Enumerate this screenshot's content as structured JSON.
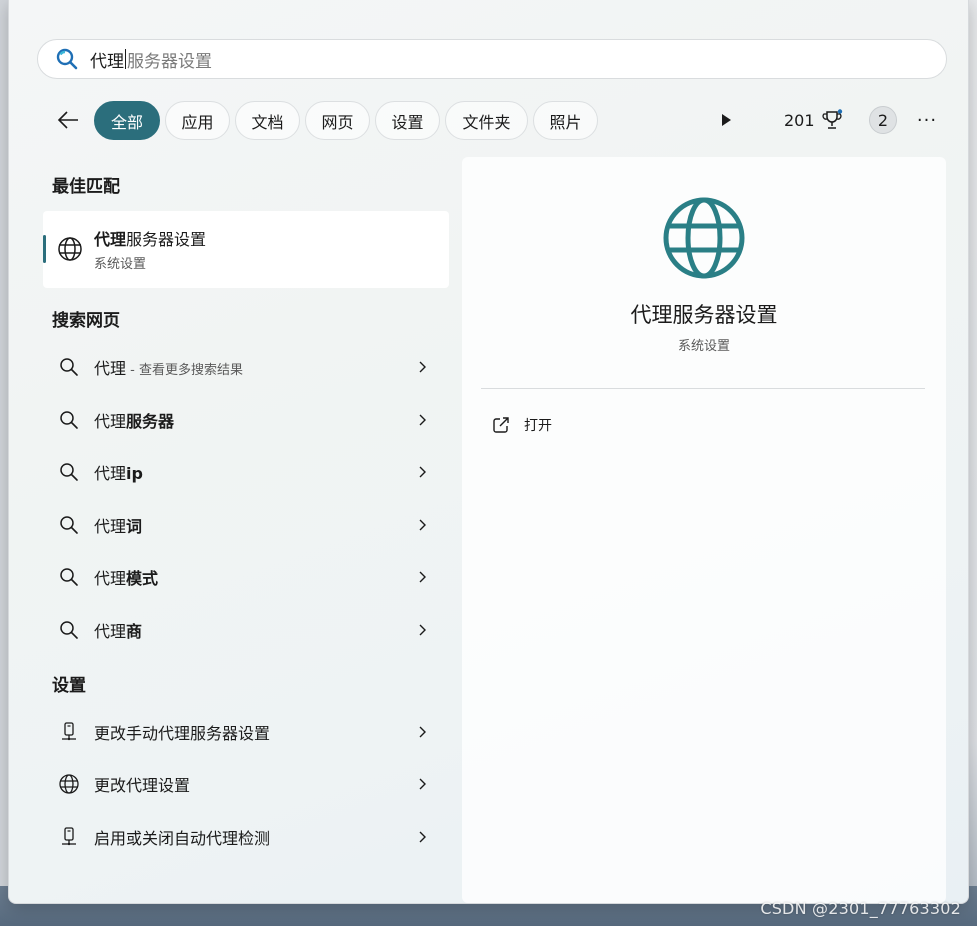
{
  "search": {
    "typed": "代理",
    "suggestion": "服务器设置"
  },
  "filters": {
    "back_icon": "arrow-left-icon",
    "chips": [
      {
        "label": "全部",
        "active": true
      },
      {
        "label": "应用",
        "active": false
      },
      {
        "label": "文档",
        "active": false
      },
      {
        "label": "网页",
        "active": false
      },
      {
        "label": "设置",
        "active": false
      },
      {
        "label": "文件夹",
        "active": false
      },
      {
        "label": "照片",
        "active": false
      }
    ],
    "points": "201",
    "badge": "2",
    "more": "···"
  },
  "best_match": {
    "heading": "最佳匹配",
    "title_bold": "代理",
    "title_rest": "服务器设置",
    "subtitle": "系统设置",
    "icon": "globe-icon"
  },
  "web": {
    "heading": "搜索网页",
    "items": [
      {
        "prefix": "代理",
        "bold": "",
        "hint": " - 查看更多搜索结果"
      },
      {
        "prefix": "代理",
        "bold": "服务器",
        "hint": ""
      },
      {
        "prefix": "代理",
        "bold": "ip",
        "hint": ""
      },
      {
        "prefix": "代理",
        "bold": "词",
        "hint": ""
      },
      {
        "prefix": "代理",
        "bold": "模式",
        "hint": ""
      },
      {
        "prefix": "代理",
        "bold": "商",
        "hint": ""
      }
    ]
  },
  "settings": {
    "heading": "设置",
    "items": [
      {
        "label": "更改手动代理服务器设置",
        "icon": "network-device-icon"
      },
      {
        "label": "更改代理设置",
        "icon": "globe-icon"
      },
      {
        "label": "启用或关闭自动代理检测",
        "icon": "network-device-icon"
      }
    ]
  },
  "preview": {
    "title": "代理服务器设置",
    "subtitle": "系统设置",
    "open_label": "打开"
  },
  "colors": {
    "accent": "#2b6e7c",
    "globe": "#2a7f86"
  },
  "watermark": "CSDN @2301_77763302"
}
